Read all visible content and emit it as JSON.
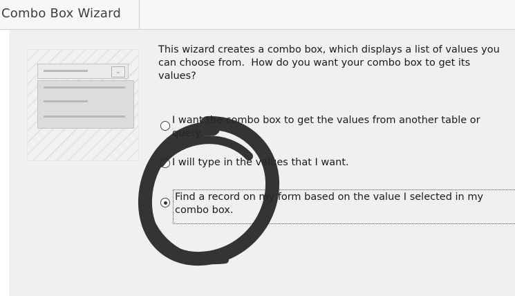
{
  "window": {
    "title": "Combo Box Wizard"
  },
  "wizard": {
    "intro": "This wizard creates a combo box, which displays a list of values you\ncan choose from.  How do you want your combo box to get its\nvalues?",
    "options": [
      {
        "label": "I want the combo box to get the values from another table or\nquery.",
        "selected": false
      },
      {
        "label": "I will type in the values that I want.",
        "selected": false
      },
      {
        "label": "Find a record on my form based on the value I selected in my\ncombo box.",
        "selected": true
      }
    ]
  },
  "annotation": {
    "color": "#262626"
  }
}
